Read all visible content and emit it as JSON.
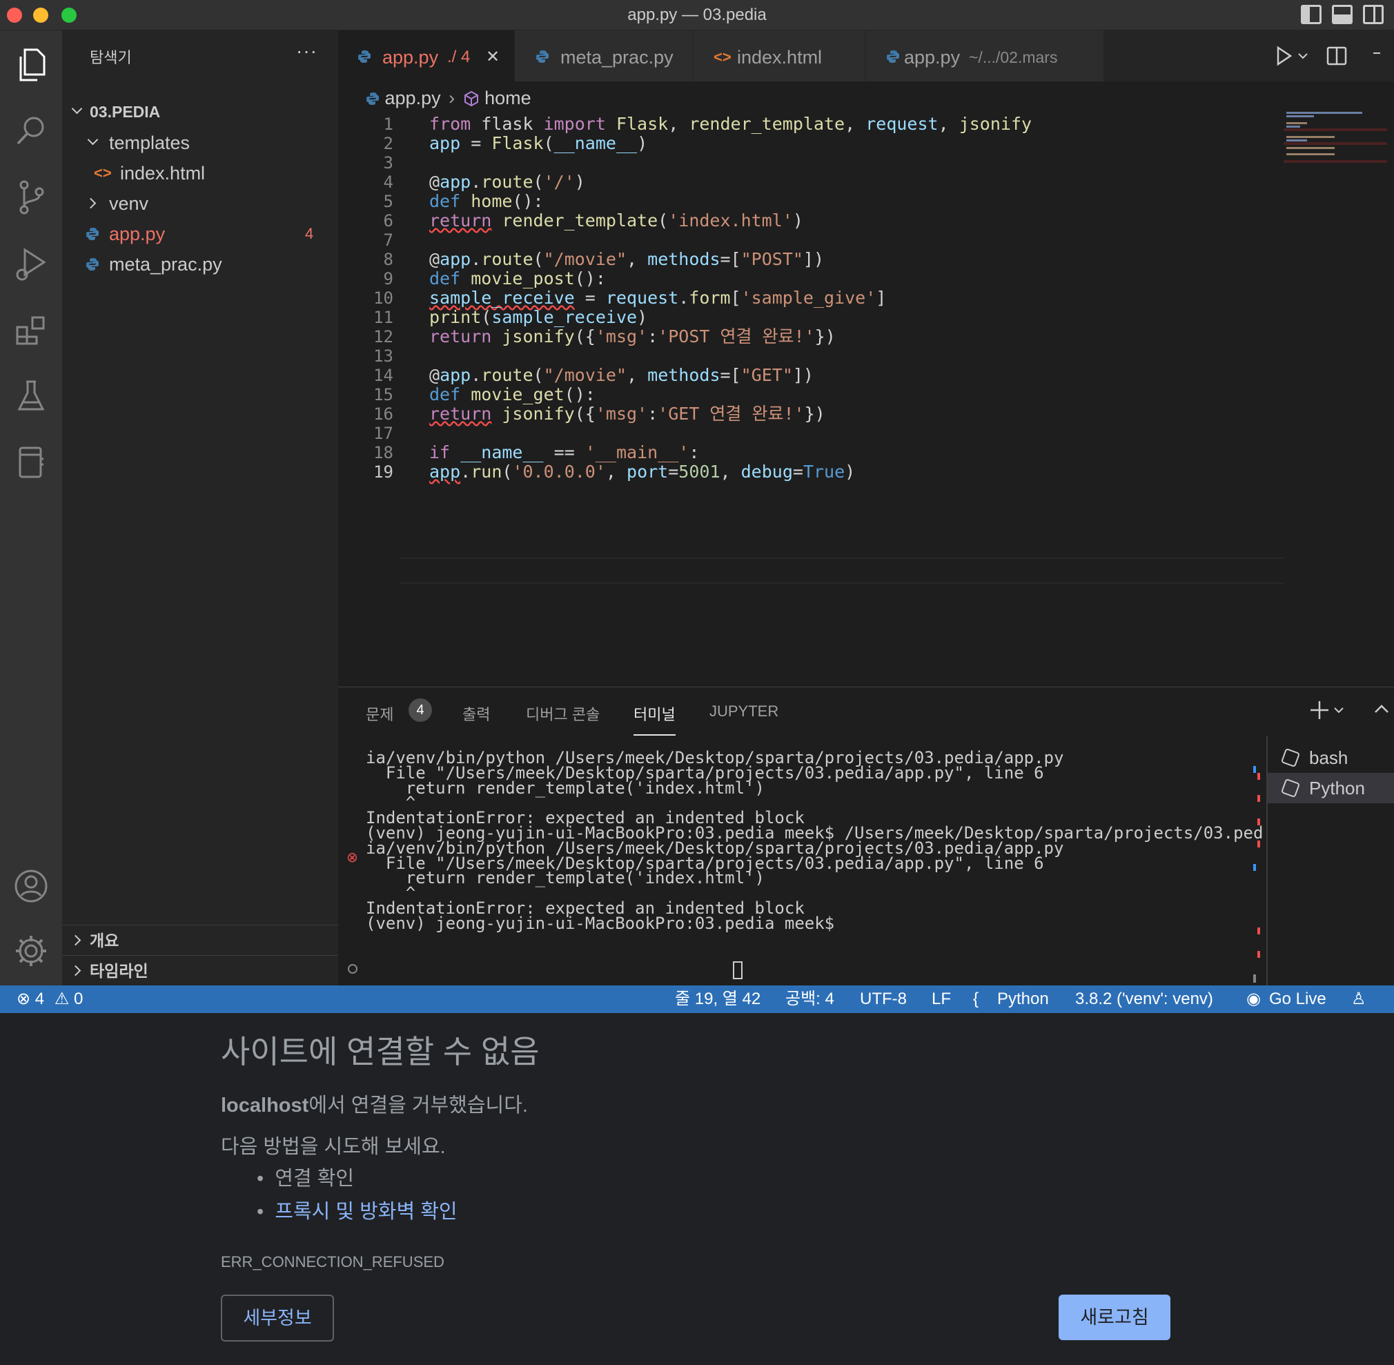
{
  "window": {
    "title": "app.py — 03.pedia"
  },
  "sidebar": {
    "title": "탐색기",
    "more": "···",
    "folder": "03.PEDIA",
    "items": [
      {
        "label": "templates"
      },
      {
        "label": "index.html"
      },
      {
        "label": "venv"
      },
      {
        "label": "app.py",
        "badge": "4"
      },
      {
        "label": "meta_prac.py"
      }
    ],
    "sections": [
      {
        "label": "개요"
      },
      {
        "label": "타임라인"
      }
    ]
  },
  "tabs": [
    {
      "label": "app.py",
      "detail": "./ 4",
      "close": "✕"
    },
    {
      "label": "meta_prac.py",
      "detail": ""
    },
    {
      "label": "index.html",
      "detail": ""
    },
    {
      "label": "app.py",
      "detail": "~/.../02.mars"
    }
  ],
  "breadcrumb": {
    "file": "app.py",
    "symbol": "home"
  },
  "code_lines": [
    "from flask import Flask, render_template, request, jsonify",
    "app = Flask(__name__)",
    "",
    "@app.route('/')",
    "def home():",
    "return render_template('index.html')",
    "",
    "@app.route(\"/movie\", methods=[\"POST\"])",
    "def movie_post():",
    "sample_receive = request.form['sample_give']",
    "print(sample_receive)",
    "return jsonify({'msg':'POST 연결 완료!'})",
    "",
    "@app.route(\"/movie\", methods=[\"GET\"])",
    "def movie_get():",
    "return jsonify({'msg':'GET 연결 완료!'})",
    "",
    "if __name__ == '__main__':",
    "app.run('0.0.0.0', port=5001, debug=True)"
  ],
  "line_numbers": [
    "1",
    "2",
    "3",
    "4",
    "5",
    "6",
    "7",
    "8",
    "9",
    "10",
    "11",
    "12",
    "13",
    "14",
    "15",
    "16",
    "17",
    "18",
    "19"
  ],
  "panel": {
    "tabs": [
      "문제",
      "출력",
      "디버그 콘솔",
      "터미널",
      "JUPYTER"
    ],
    "problems_count": "4",
    "active_tab": "터미널",
    "terminal_lines": [
      "ia/venv/bin/python /Users/meek/Desktop/sparta/projects/03.pedia/app.py",
      "  File \"/Users/meek/Desktop/sparta/projects/03.pedia/app.py\", line 6",
      "    return render_template('index.html')",
      "    ^",
      "IndentationError: expected an indented block",
      "(venv) jeong-yujin-ui-MacBookPro:03.pedia meek$ /Users/meek/Desktop/sparta/projects/03.ped",
      "ia/venv/bin/python /Users/meek/Desktop/sparta/projects/03.pedia/app.py",
      "  File \"/Users/meek/Desktop/sparta/projects/03.pedia/app.py\", line 6",
      "    return render_template('index.html')",
      "    ^",
      "IndentationError: expected an indented block",
      "(venv) jeong-yujin-ui-MacBookPro:03.pedia meek$ "
    ],
    "terminals": [
      "bash",
      "Python"
    ]
  },
  "statusbar": {
    "errors": "4",
    "warnings": "0",
    "position": "줄 19, 열 42",
    "spaces": "공백: 4",
    "encoding": "UTF-8",
    "eol": "LF",
    "language": "Python",
    "interpreter": "3.8.2 ('venv': venv)",
    "golive": "Go Live"
  },
  "browser_error": {
    "title": "사이트에 연결할 수 없음",
    "host": "localhost",
    "message": "에서 연결을 거부했습니다.",
    "try_label": "다음 방법을 시도해 보세요.",
    "suggestions": [
      "연결 확인",
      "프록시 및 방화벽 확인"
    ],
    "code": "ERR_CONNECTION_REFUSED",
    "details_button": "세부정보",
    "reload_button": "새로고침"
  },
  "colors": {
    "accent": "#2d6fb6",
    "error": "#f14c4c",
    "link": "#8ab4f8"
  }
}
